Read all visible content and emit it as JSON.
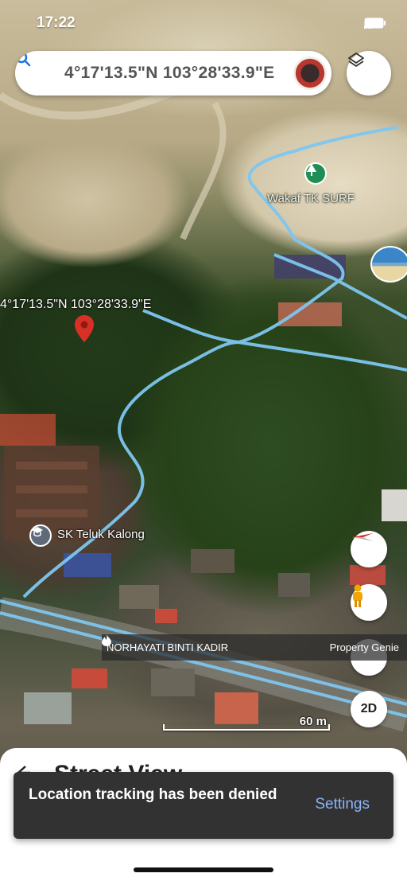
{
  "status_bar": {
    "time": "17:22"
  },
  "search": {
    "query": "4°17'13.5\"N 103°28'33.9\"E"
  },
  "map": {
    "pin_label": "4°17'13.5\"N 103°28'33.9\"E",
    "poi_surf": "Wakaf TK SURF",
    "poi_school": "SK Teluk Kalong",
    "scale_label": "60 m",
    "attribution_left": "NORHAYATI BINTI KADIR",
    "attribution_right": "Property Genie",
    "map_type_button": "2D",
    "icons": {
      "search": "search-icon",
      "layers": "layers-icon",
      "pin": "red-pin-icon",
      "surf": "tree-icon",
      "school": "school-icon",
      "compass": "compass-icon",
      "pegman": "pegman-icon"
    },
    "colors": {
      "route": "#7ec6ef",
      "pin": "#d93025",
      "snackbar_action": "#8ab4f8"
    }
  },
  "sheet": {
    "title": "Street View"
  },
  "snackbar": {
    "message": "Location tracking has been denied",
    "action": "Settings"
  }
}
